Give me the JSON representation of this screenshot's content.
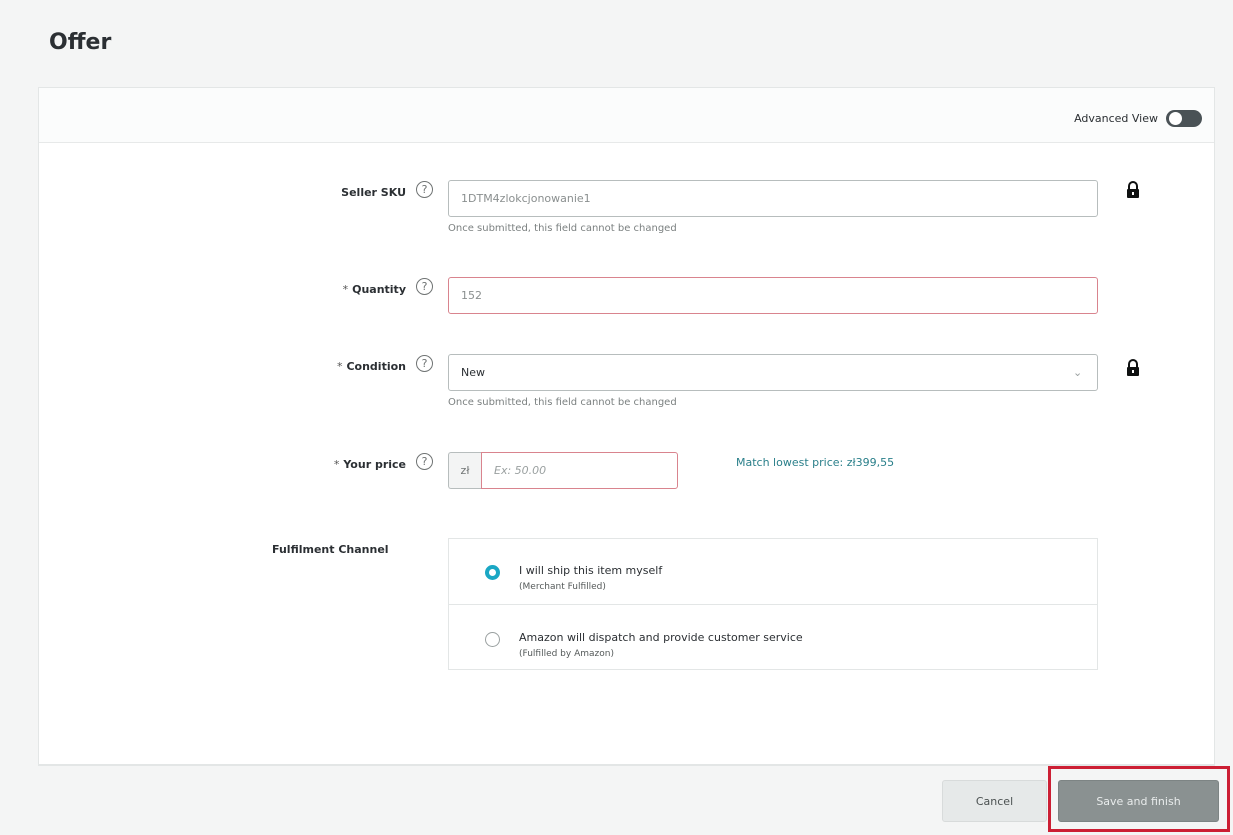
{
  "page": {
    "title": "Offer"
  },
  "header": {
    "advanced_view_label": "Advanced View"
  },
  "form": {
    "seller_sku": {
      "label": "Seller SKU",
      "value": "1DTM4zlokcjonowanie1",
      "hint": "Once submitted, this field cannot be changed"
    },
    "quantity": {
      "required": "*",
      "label": "Quantity",
      "value": "152"
    },
    "condition": {
      "required": "*",
      "label": "Condition",
      "value": "New",
      "hint": "Once submitted, this field cannot be changed"
    },
    "price": {
      "required": "*",
      "label": "Your price",
      "currency": "zł",
      "placeholder": "Ex: 50.00",
      "match_link": "Match lowest price: zł399,55"
    },
    "fulfilment": {
      "label": "Fulfilment Channel",
      "options": [
        {
          "main": "I will ship this item myself",
          "sub": "(Merchant Fulfilled)",
          "checked": true
        },
        {
          "main": "Amazon will dispatch and provide customer service",
          "sub": "(Fulfilled by Amazon)",
          "checked": false
        }
      ]
    }
  },
  "footer": {
    "cancel_label": "Cancel",
    "save_label": "Save and finish"
  },
  "colors": {
    "accent": "#1aa7c4",
    "error_border": "#d9848e",
    "highlight": "#cc1f34",
    "link": "#2a7f8a"
  },
  "icons": {
    "help": "help-circle-icon",
    "lock": "lock-icon",
    "chevron": "chevron-down-icon"
  }
}
